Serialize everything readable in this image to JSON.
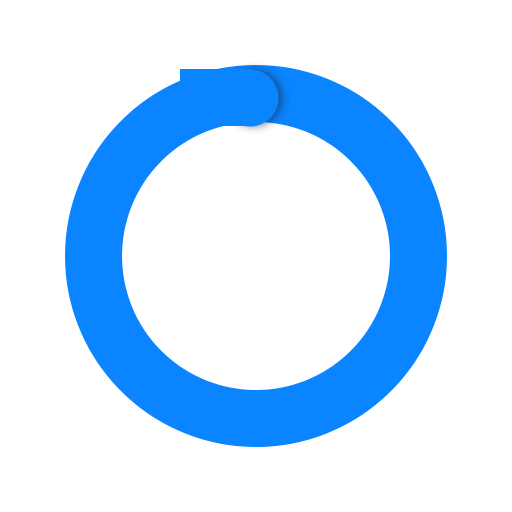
{
  "progress_ring": {
    "progress_fraction": 1.0,
    "arc_color": "#0A84FF",
    "track_color": "#0A84FF",
    "end_shadow_color": "#1b2a40",
    "background_color": "#FFFFFF",
    "icon": "progress-ring-icon"
  }
}
